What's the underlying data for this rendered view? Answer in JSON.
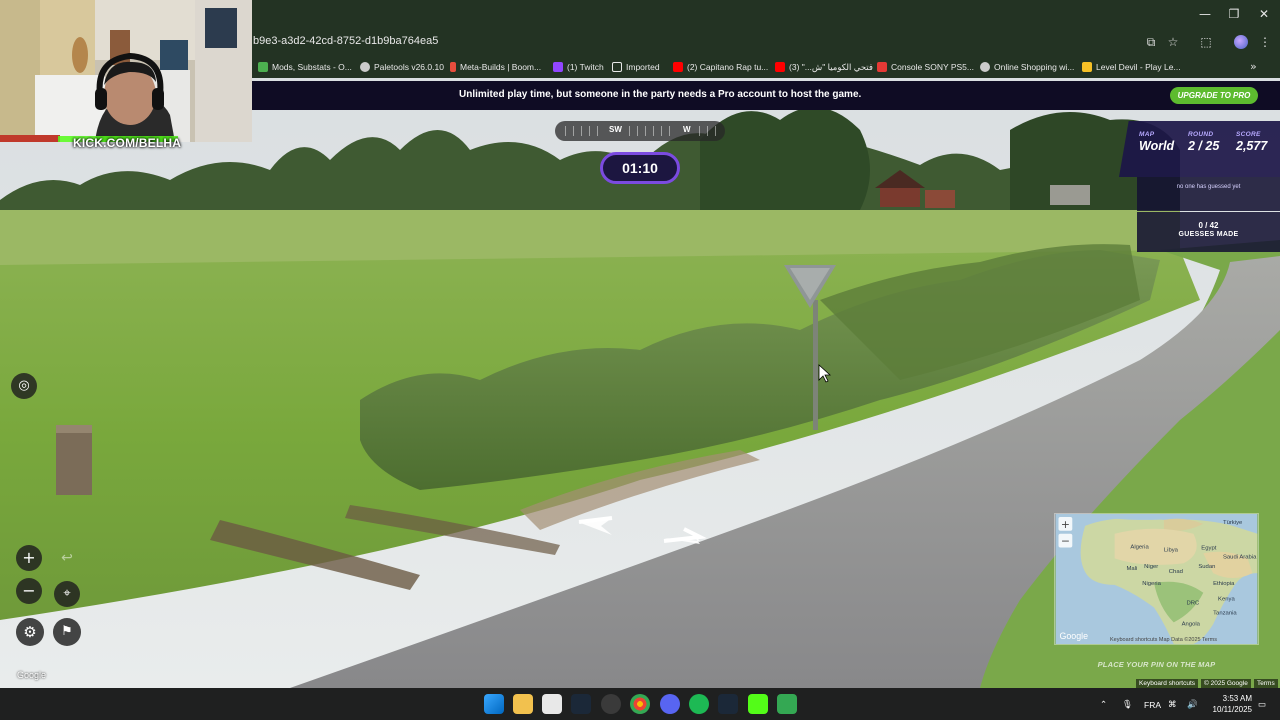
{
  "browser": {
    "url_fragment": "b9e3-a3d2-42cd-8752-d1b9ba764ea5",
    "bookmarks": [
      {
        "label": "Mods, Substats - O...",
        "color": "#4caf50"
      },
      {
        "label": "Paletools v26.0.10",
        "color": "#cccccc"
      },
      {
        "label": "Meta-Builds | Boom...",
        "color": "#e84d3d"
      },
      {
        "label": "(1) Twitch",
        "color": "#9146ff"
      },
      {
        "label": "Imported",
        "color": "#e8e8e8"
      },
      {
        "label": "(2) Capitano Rap tu...",
        "color": "#ff0000"
      },
      {
        "label": "فتحي الكوميا \"ش...\" (3)",
        "color": "#ff0000"
      },
      {
        "label": "Console SONY PS5...",
        "color": "#e53935"
      },
      {
        "label": "Online Shopping wi...",
        "color": "#cccccc"
      },
      {
        "label": "Level Devil - Play Le...",
        "color": "#f6c026"
      }
    ]
  },
  "banner": {
    "text": "Unlimited play time, but someone in the party needs a Pro account to host the game.",
    "upgrade_label": "UPGRADE TO PRO"
  },
  "webcam": {
    "overlay_text": "KICK.COM/BELHA"
  },
  "compass": {
    "dir_left": "SW",
    "dir_right": "W"
  },
  "timer": "01:10",
  "status": {
    "map_label": "MAP",
    "map_value": "World",
    "round_label": "ROUND",
    "round_value": "2 / 25",
    "score_label": "SCORE",
    "score_value": "2,577",
    "message": "no one has guessed yet",
    "guesses_count": "0 / 42",
    "guesses_label": "GUESSES MADE"
  },
  "streetview": {
    "google_label": "Google",
    "attrib_shortcuts": "Keyboard shortcuts",
    "attrib_data": "© 2025 Google",
    "attrib_terms": "Terms"
  },
  "minimap": {
    "labels": [
      "Türkiye",
      "Algeria",
      "Libya",
      "Egypt",
      "Saudi Arabia",
      "Mali",
      "Niger",
      "Chad",
      "Sudan",
      "Nigeria",
      "Ethiopia",
      "DRC",
      "Kenya",
      "Tanzania",
      "Angola"
    ],
    "footer": "Keyboard shortcuts   Map Data ©2025   Terms",
    "google": "Google",
    "place_pin": "PLACE YOUR PIN ON THE MAP"
  },
  "taskbar": {
    "language": "FRA",
    "time": "3:53 AM",
    "date": "10/11/2025"
  },
  "colors": {
    "accent_purple": "#7b4be0",
    "upgrade_green": "#5dbb2f",
    "browser_chrome": "#233323"
  }
}
